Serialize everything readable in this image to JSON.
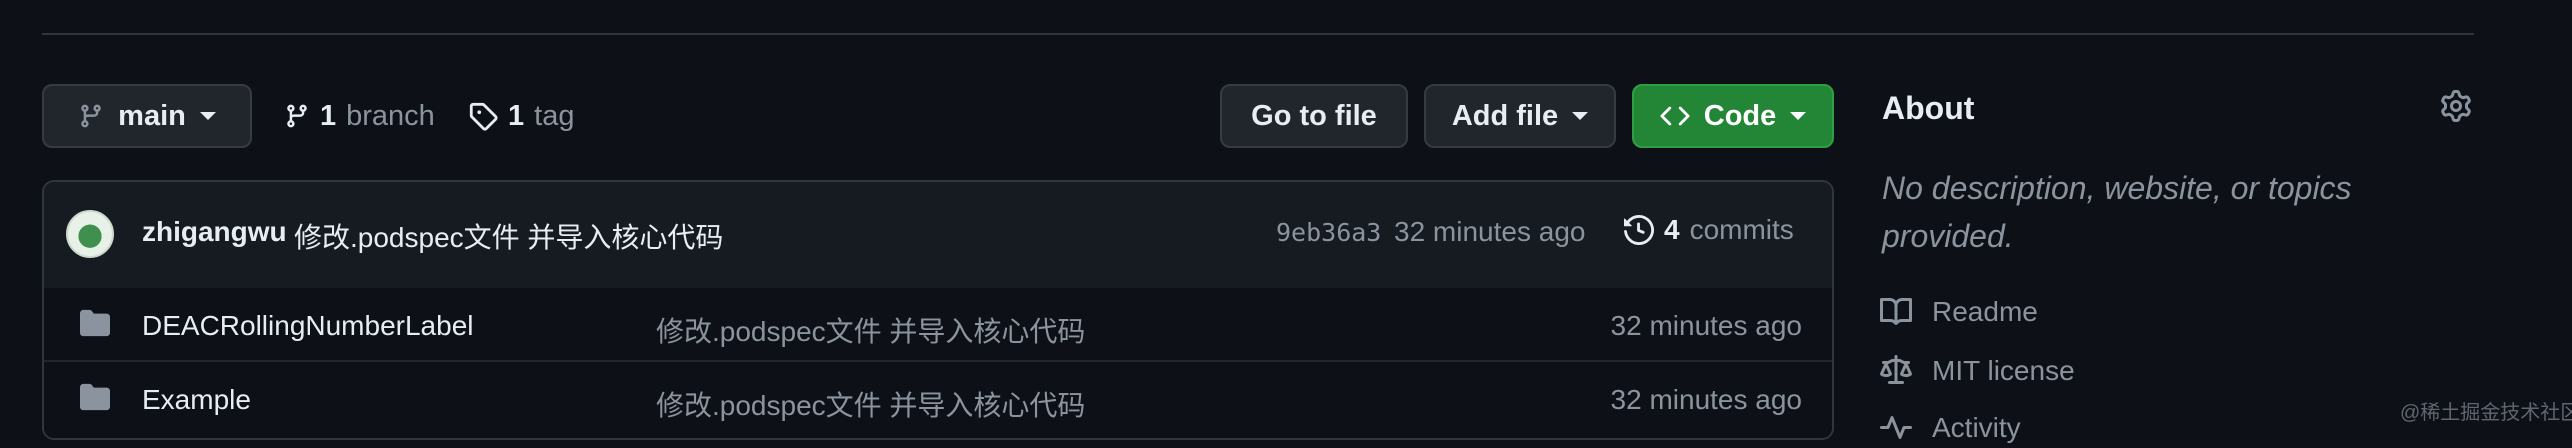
{
  "branch_selector": {
    "label": "main"
  },
  "branches": {
    "count": "1",
    "label": "branch"
  },
  "tags": {
    "count": "1",
    "label": "tag"
  },
  "toolbar": {
    "go_to_file": "Go to file",
    "add_file": "Add file",
    "code": "Code",
    "code_color": "#238636"
  },
  "latest_commit": {
    "author": "zhigangwu",
    "message": "修改.podspec文件 并导入核心代码",
    "sha": "9eb36a3",
    "time": "32 minutes ago",
    "commits_count": "4",
    "commits_label": "commits"
  },
  "files": [
    {
      "name": "DEACRollingNumberLabel",
      "message": "修改.podspec文件 并导入核心代码",
      "time": "32 minutes ago",
      "icon": "folder-icon"
    },
    {
      "name": "Example",
      "message": "修改.podspec文件 并导入核心代码",
      "time": "32 minutes ago",
      "icon": "folder-icon"
    }
  ],
  "about": {
    "title": "About",
    "description": "No description, website, or topics provided.",
    "links": [
      {
        "label": "Readme",
        "icon": "book-icon"
      },
      {
        "label": "MIT license",
        "icon": "scale-icon"
      },
      {
        "label": "Activity",
        "icon": "pulse-icon"
      }
    ]
  },
  "watermark": "@稀土掘金技术社区"
}
